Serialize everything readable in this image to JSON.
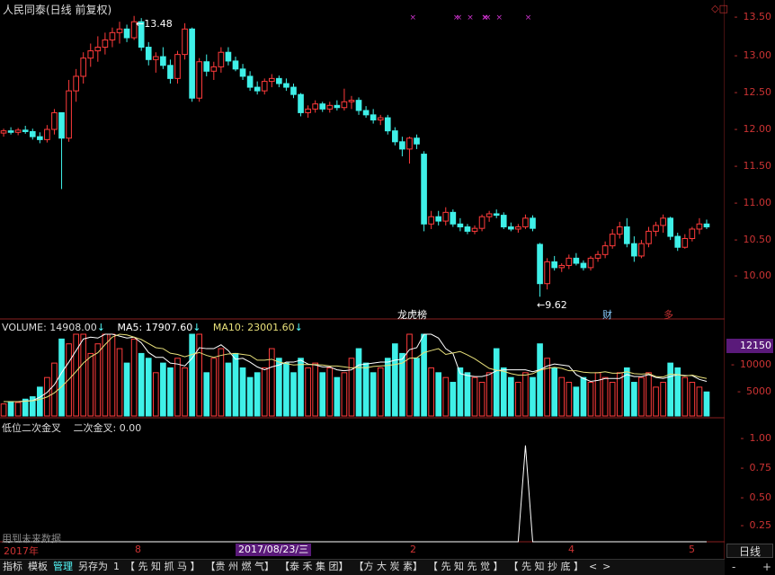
{
  "header": {
    "stock_title": "人民同泰(日线 前复权)"
  },
  "price_axis": {
    "labels": [
      "13.50",
      "13.00",
      "12.50",
      "12.00",
      "11.50",
      "11.00",
      "10.50",
      "10.00"
    ]
  },
  "annotations": {
    "high_label": "13.48",
    "low_label": "9.62",
    "event_label_1": "龙虎榜",
    "event_label_2": "财",
    "event_label_3": "多"
  },
  "volume_panel": {
    "volume_label": "VOLUME: 14908.00",
    "ma5_label": "MA5: 17907.60",
    "ma10_label": "MA10: 23001.60",
    "badge_value": "12150",
    "axis_labels": [
      "10000",
      "5000"
    ]
  },
  "indicator_panel": {
    "title": "低位二次金叉",
    "value_label": "二次金叉: 0.00",
    "axis_labels": [
      "1.00",
      "0.75",
      "0.50",
      "0.25"
    ],
    "watermark": "用到未来数据"
  },
  "x_axis": {
    "labels": [
      "2017年",
      "8",
      "2",
      "4",
      "5"
    ],
    "selected_date": "2017/08/23/三"
  },
  "period": {
    "label": "日线"
  },
  "zoom": {
    "minus": "-",
    "plus": "+"
  },
  "tabs": [
    {
      "label": "指标",
      "active": false
    },
    {
      "label": "模板",
      "active": false
    },
    {
      "label": "管理",
      "active": true
    },
    {
      "label": "另存为",
      "active": false
    },
    {
      "label": "1",
      "active": false
    },
    {
      "label": "【 先 知 抓 马 】",
      "active": false
    },
    {
      "label": "【贵 州 燃 气】",
      "active": false
    },
    {
      "label": "【泰 禾 集 团】",
      "active": false
    },
    {
      "label": "【方 大 炭 素】",
      "active": false
    },
    {
      "label": "【 先 知 先 觉 】",
      "active": false
    },
    {
      "label": "【 先 知 抄 底 】",
      "active": false
    },
    {
      "label": "<",
      "active": false
    },
    {
      "label": ">",
      "active": false
    }
  ],
  "chart_data": {
    "type": "candlestick",
    "up_color": "#ff3b3b",
    "down_color": "#3ff0e8",
    "ma_color_1": "#ffffff",
    "ma_color_2": "#e8e07a",
    "candles": [
      [
        11.87,
        11.93,
        11.82,
        11.9
      ],
      [
        11.9,
        11.95,
        11.85,
        11.88
      ],
      [
        11.88,
        11.94,
        11.84,
        11.91
      ],
      [
        11.91,
        11.97,
        11.86,
        11.89
      ],
      [
        11.89,
        11.93,
        11.78,
        11.82
      ],
      [
        11.82,
        11.88,
        11.73,
        11.78
      ],
      [
        11.78,
        11.98,
        11.74,
        11.92
      ],
      [
        11.92,
        12.2,
        11.85,
        12.15
      ],
      [
        12.15,
        12.05,
        11.1,
        11.8
      ],
      [
        11.8,
        12.6,
        11.75,
        12.45
      ],
      [
        12.45,
        12.75,
        12.3,
        12.65
      ],
      [
        12.65,
        12.98,
        12.55,
        12.9
      ],
      [
        12.9,
        13.1,
        12.78,
        13.0
      ],
      [
        13.0,
        13.2,
        12.85,
        13.05
      ],
      [
        13.05,
        13.25,
        12.95,
        13.15
      ],
      [
        13.15,
        13.32,
        13.05,
        13.25
      ],
      [
        13.25,
        13.4,
        13.1,
        13.3
      ],
      [
        13.3,
        13.36,
        13.12,
        13.18
      ],
      [
        13.18,
        13.48,
        13.15,
        13.4
      ],
      [
        13.4,
        13.45,
        13.0,
        13.05
      ],
      [
        13.05,
        13.12,
        12.8,
        12.88
      ],
      [
        12.88,
        12.98,
        12.7,
        12.92
      ],
      [
        12.92,
        13.05,
        12.75,
        12.8
      ],
      [
        12.8,
        12.88,
        12.55,
        12.62
      ],
      [
        12.62,
        13.0,
        12.55,
        12.95
      ],
      [
        12.95,
        13.38,
        12.88,
        13.3
      ],
      [
        13.3,
        13.32,
        12.3,
        12.35
      ],
      [
        12.35,
        12.9,
        12.3,
        12.85
      ],
      [
        12.85,
        12.95,
        12.65,
        12.72
      ],
      [
        12.72,
        12.85,
        12.6,
        12.78
      ],
      [
        12.78,
        13.05,
        12.7,
        12.98
      ],
      [
        12.98,
        13.05,
        12.8,
        12.86
      ],
      [
        12.86,
        12.92,
        12.72,
        12.75
      ],
      [
        12.75,
        12.82,
        12.6,
        12.65
      ],
      [
        12.65,
        12.72,
        12.45,
        12.5
      ],
      [
        12.5,
        12.58,
        12.4,
        12.45
      ],
      [
        12.45,
        12.62,
        12.4,
        12.58
      ],
      [
        12.58,
        12.68,
        12.5,
        12.62
      ],
      [
        12.62,
        12.66,
        12.5,
        12.55
      ],
      [
        12.55,
        12.62,
        12.45,
        12.5
      ],
      [
        12.5,
        12.55,
        12.35,
        12.4
      ],
      [
        12.4,
        12.42,
        12.1,
        12.15
      ],
      [
        12.15,
        12.25,
        12.08,
        12.2
      ],
      [
        12.2,
        12.32,
        12.15,
        12.27
      ],
      [
        12.27,
        12.3,
        12.16,
        12.2
      ],
      [
        12.2,
        12.3,
        12.15,
        12.25
      ],
      [
        12.25,
        12.32,
        12.18,
        12.22
      ],
      [
        12.22,
        12.48,
        12.18,
        12.3
      ],
      [
        12.3,
        12.38,
        12.2,
        12.32
      ],
      [
        12.32,
        12.36,
        12.12,
        12.18
      ],
      [
        12.18,
        12.24,
        12.08,
        12.12
      ],
      [
        12.12,
        12.2,
        12.0,
        12.05
      ],
      [
        12.05,
        12.12,
        11.98,
        12.08
      ],
      [
        12.08,
        12.12,
        11.85,
        11.9
      ],
      [
        11.9,
        11.95,
        11.7,
        11.75
      ],
      [
        11.75,
        11.82,
        11.55,
        11.65
      ],
      [
        11.65,
        11.82,
        11.45,
        11.8
      ],
      [
        11.8,
        11.85,
        11.65,
        11.72
      ],
      [
        11.58,
        11.62,
        10.52,
        10.62
      ],
      [
        10.62,
        10.8,
        10.55,
        10.72
      ],
      [
        10.72,
        10.8,
        10.6,
        10.66
      ],
      [
        10.66,
        10.85,
        10.6,
        10.78
      ],
      [
        10.78,
        10.82,
        10.58,
        10.62
      ],
      [
        10.62,
        10.7,
        10.52,
        10.58
      ],
      [
        10.58,
        10.62,
        10.48,
        10.52
      ],
      [
        10.52,
        10.6,
        10.48,
        10.56
      ],
      [
        10.56,
        10.75,
        10.52,
        10.72
      ],
      [
        10.72,
        10.8,
        10.65,
        10.76
      ],
      [
        10.76,
        10.82,
        10.7,
        10.74
      ],
      [
        10.74,
        10.78,
        10.55,
        10.58
      ],
      [
        10.58,
        10.64,
        10.52,
        10.55
      ],
      [
        10.55,
        10.62,
        10.5,
        10.58
      ],
      [
        10.58,
        10.75,
        10.55,
        10.7
      ],
      [
        10.7,
        10.74,
        10.52,
        10.56
      ],
      [
        10.34,
        10.36,
        9.62,
        9.8
      ],
      [
        9.8,
        10.15,
        9.72,
        10.1
      ],
      [
        10.1,
        10.18,
        9.98,
        10.02
      ],
      [
        10.02,
        10.08,
        9.96,
        10.05
      ],
      [
        10.05,
        10.2,
        10.0,
        10.15
      ],
      [
        10.15,
        10.22,
        10.05,
        10.08
      ],
      [
        10.08,
        10.12,
        9.98,
        10.02
      ],
      [
        10.02,
        10.18,
        9.98,
        10.15
      ],
      [
        10.15,
        10.25,
        10.1,
        10.2
      ],
      [
        10.2,
        10.38,
        10.15,
        10.32
      ],
      [
        10.32,
        10.55,
        10.28,
        10.48
      ],
      [
        10.48,
        10.65,
        10.42,
        10.58
      ],
      [
        10.58,
        10.7,
        10.3,
        10.35
      ],
      [
        10.35,
        10.45,
        10.1,
        10.18
      ],
      [
        10.18,
        10.4,
        10.15,
        10.35
      ],
      [
        10.35,
        10.58,
        10.3,
        10.52
      ],
      [
        10.52,
        10.65,
        10.45,
        10.6
      ],
      [
        10.6,
        10.75,
        10.5,
        10.7
      ],
      [
        10.7,
        10.72,
        10.4,
        10.45
      ],
      [
        10.45,
        10.5,
        10.25,
        10.3
      ],
      [
        10.3,
        10.48,
        10.28,
        10.42
      ],
      [
        10.42,
        10.58,
        10.38,
        10.55
      ],
      [
        10.55,
        10.7,
        10.48,
        10.62
      ],
      [
        10.62,
        10.68,
        10.55,
        10.58
      ]
    ],
    "volumes": [
      2500,
      3000,
      2800,
      3500,
      4000,
      6000,
      8000,
      11000,
      16000,
      15000,
      18000,
      20000,
      13000,
      15000,
      19000,
      22000,
      14000,
      11000,
      16000,
      13000,
      12000,
      9000,
      11000,
      10000,
      12000,
      10000,
      17000,
      22000,
      9000,
      12000,
      14000,
      11000,
      13000,
      10000,
      8000,
      9000,
      10000,
      14000,
      12000,
      11000,
      9000,
      12000,
      10000,
      11000,
      9000,
      10000,
      8000,
      9000,
      12000,
      14000,
      11000,
      9000,
      10000,
      12000,
      15000,
      13000,
      19000,
      12000,
      31000,
      10000,
      9000,
      8000,
      7000,
      10000,
      9000,
      8000,
      7000,
      9000,
      14000,
      10000,
      8000,
      7000,
      9000,
      8000,
      15000,
      12000,
      10000,
      8000,
      7000,
      6000,
      8000,
      7000,
      9000,
      8000,
      7000,
      9000,
      10000,
      7000,
      8000,
      9000,
      6000,
      7000,
      11000,
      10000,
      8000,
      7000,
      6000,
      5000
    ],
    "ma5_volume": [
      3000,
      3000,
      3000,
      3100,
      3200,
      3900,
      4900,
      6500,
      9000,
      11200,
      13600,
      16000,
      16400,
      16200,
      17000,
      17800,
      16600,
      16200,
      16400,
      15200,
      13200,
      12200,
      12200,
      11000,
      10800,
      10400,
      12000,
      14200,
      14000,
      14000,
      14800,
      13600,
      11800,
      12000,
      11200,
      10200,
      9600,
      10200,
      10600,
      11200,
      11200,
      11600,
      10800,
      10600,
      10200,
      10200,
      9600,
      9400,
      9600,
      10600,
      10800,
      11000,
      11200,
      11200,
      11600,
      11800,
      13800,
      14200,
      18000,
      17000,
      16200,
      14000,
      13000,
      8800,
      8400,
      8200,
      8200,
      8600,
      9400,
      9600,
      9600,
      9600,
      9600,
      9200,
      9600,
      10400,
      10800,
      10600,
      10400,
      8600,
      7800,
      7200,
      7400,
      7800,
      7800,
      7800,
      8600,
      8200,
      8200,
      8600,
      8000,
      7800,
      8200,
      8600,
      8400,
      8400,
      7600,
      7200
    ],
    "ma10_volume": [
      3000,
      3000,
      3000,
      3050,
      3150,
      3450,
      3950,
      4800,
      6100,
      7600,
      9250,
      11000,
      12300,
      13150,
      14850,
      16400,
      17100,
      16850,
      16400,
      15900,
      15050,
      14200,
      14000,
      13050,
      12800,
      12300,
      12800,
      13200,
      12600,
      12200,
      12600,
      12900,
      13000,
      12800,
      12600,
      11600,
      11600,
      11800,
      11200,
      10900,
      10600,
      10700,
      10700,
      10700,
      10600,
      10400,
      10400,
      10200,
      10000,
      10100,
      10000,
      10300,
      10400,
      10500,
      10700,
      11000,
      12000,
      12100,
      13200,
      13600,
      14000,
      12800,
      13100,
      13400,
      12700,
      11900,
      10900,
      9900,
      9500,
      9300,
      8800,
      8500,
      8500,
      8800,
      9500,
      9900,
      10100,
      9900,
      9400,
      9400,
      9100,
      9000,
      9000,
      9200,
      8900,
      8900,
      9200,
      8800,
      8700,
      8800,
      8200,
      8100,
      8700,
      8600,
      8300,
      8500,
      8100,
      7800
    ],
    "signal": {
      "peak_index": 72,
      "peak_value": 1.0
    },
    "price_range": [
      9.5,
      13.6
    ],
    "volume_range": [
      0,
      17000
    ],
    "indicator_range": [
      0,
      1.1
    ]
  }
}
